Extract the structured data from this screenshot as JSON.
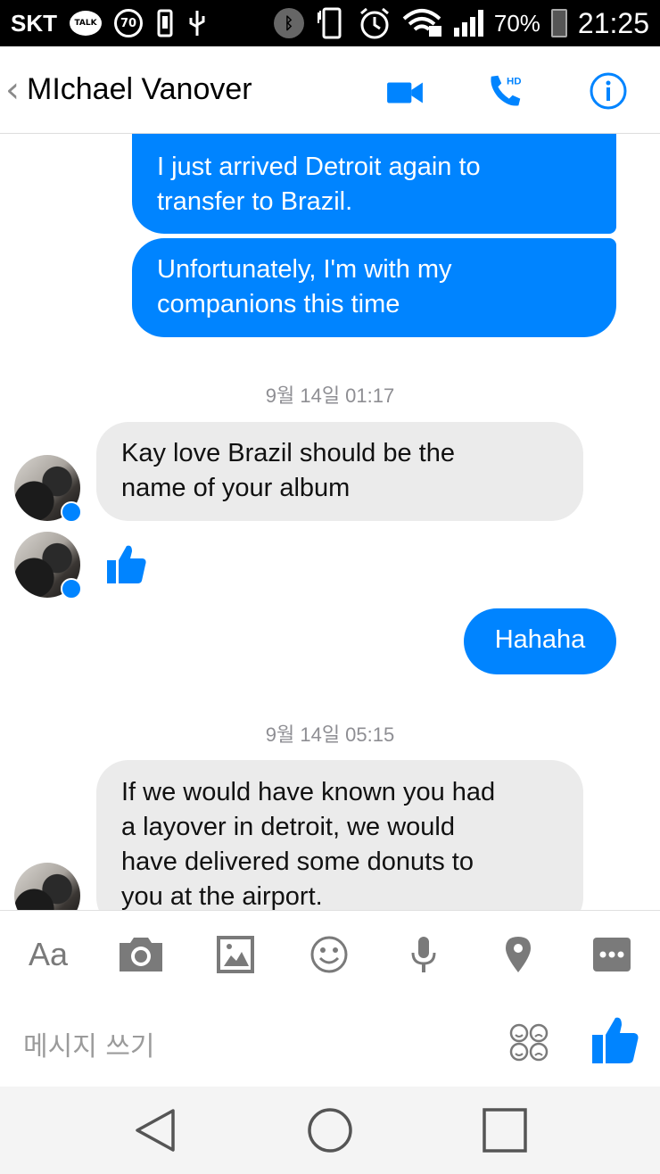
{
  "status_bar": {
    "carrier": "SKT",
    "talk_badge": "TALK",
    "notification_count": "70",
    "battery_percent": "70%",
    "time": "21:25"
  },
  "header": {
    "contact_name": "MIchael Vanover"
  },
  "thread": {
    "messages": [
      {
        "direction": "outgoing",
        "text_lines": [
          "I just arrived Detroit again to",
          "transfer to Brazil."
        ]
      },
      {
        "direction": "outgoing",
        "text_lines": [
          "Unfortunately, I'm with my",
          "companions this time"
        ]
      },
      {
        "type": "timestamp",
        "text": "9월 14일 01:17"
      },
      {
        "direction": "incoming",
        "text_lines": [
          "Kay love Brazil should be the",
          "name of your album"
        ]
      },
      {
        "direction": "incoming",
        "type": "like-sticker"
      },
      {
        "direction": "outgoing",
        "text_lines": [
          "Hahaha"
        ]
      },
      {
        "type": "timestamp",
        "text": "9월 14일 05:15"
      },
      {
        "direction": "incoming",
        "text_lines": [
          "If we would have known you had",
          "a layover in detroit, we would",
          "have delivered some donuts to",
          "you at the airport."
        ]
      }
    ]
  },
  "toolbar": {
    "text_format_label": "Aa",
    "icons": [
      "text-format-icon",
      "camera-icon",
      "gallery-icon",
      "emoji-icon",
      "microphone-icon",
      "location-icon",
      "more-icon"
    ]
  },
  "composer": {
    "placeholder": "메시지 쓰기"
  },
  "colors": {
    "accent": "#0084ff",
    "incoming_bubble": "#ebebeb",
    "timestamp_text": "#8e8e93"
  }
}
